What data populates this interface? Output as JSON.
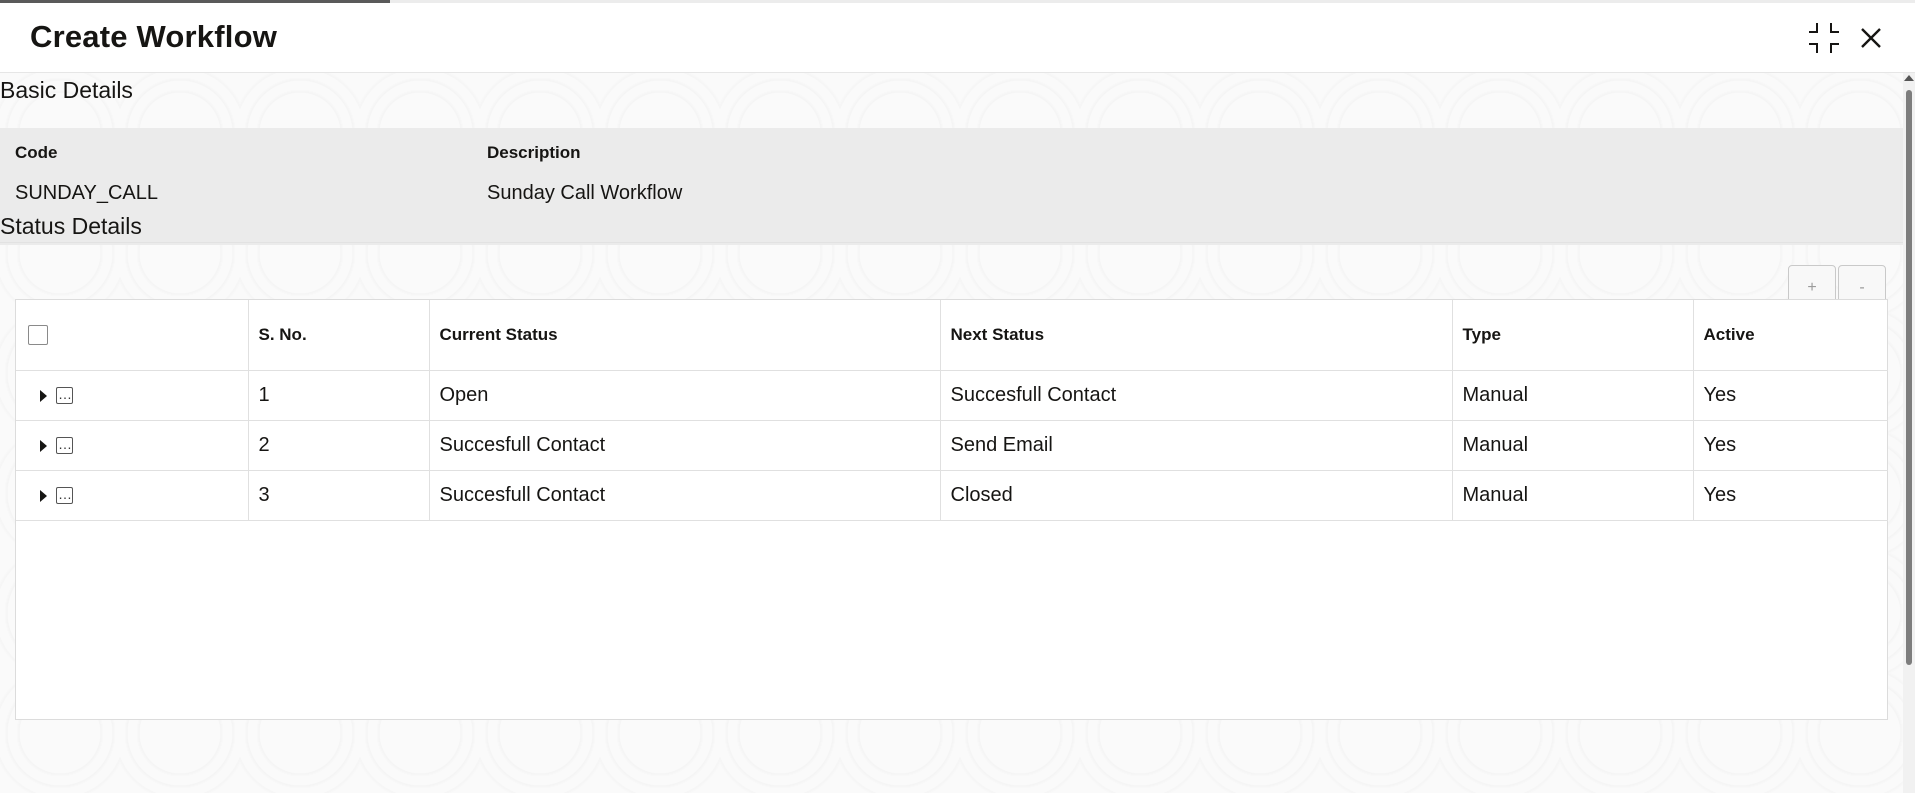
{
  "window": {
    "title": "Create Workflow",
    "minimize_icon": "collapse-icon",
    "close_icon": "close-icon"
  },
  "basic_details": {
    "heading": "Basic Details",
    "code_label": "Code",
    "code_value": "SUNDAY_CALL",
    "description_label": "Description",
    "description_value": "Sunday Call Workflow"
  },
  "status_details": {
    "heading": "Status Details",
    "add_label": "+",
    "remove_label": "-",
    "columns": [
      "S. No.",
      "Current Status",
      "Next Status",
      "Type",
      "Active"
    ],
    "rows": [
      {
        "sno": "1",
        "current": "Open",
        "next": "Succesfull Contact",
        "type": "Manual",
        "active": "Yes"
      },
      {
        "sno": "2",
        "current": "Succesfull Contact",
        "next": "Send Email",
        "type": "Manual",
        "active": "Yes"
      },
      {
        "sno": "3",
        "current": "Succesfull Contact",
        "next": "Closed",
        "type": "Manual",
        "active": "Yes"
      }
    ]
  }
}
